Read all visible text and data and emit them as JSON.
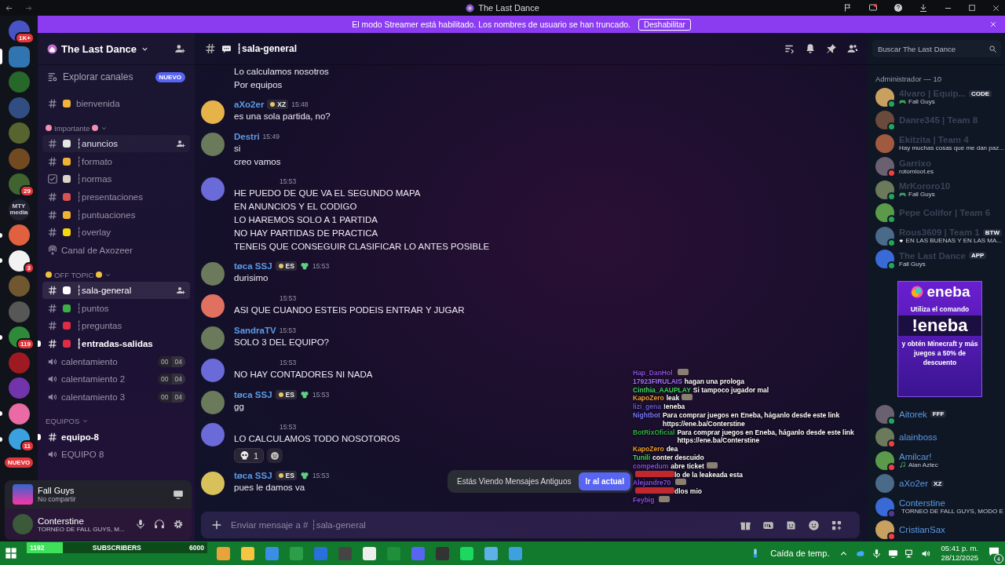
{
  "window": {
    "title": "The Last Dance"
  },
  "servers": [
    {
      "badge": "1K+",
      "selected": false,
      "unread": false
    },
    {
      "selected": true,
      "unread": false
    },
    {
      "selected": false,
      "unread": false
    },
    {
      "selected": false,
      "unread": false
    },
    {
      "selected": false,
      "unread": false
    },
    {
      "selected": false,
      "unread": false
    },
    {
      "badge": "29",
      "selected": false,
      "unread": false
    },
    {
      "label": "MTY media",
      "selected": false,
      "unread": false
    },
    {
      "selected": false,
      "unread": true
    },
    {
      "badge": "3",
      "selected": false,
      "unread": true
    },
    {
      "selected": false,
      "unread": false
    },
    {
      "selected": false,
      "unread": false
    },
    {
      "badge": "119",
      "selected": false,
      "unread": true
    },
    {
      "selected": false,
      "unread": false
    },
    {
      "selected": false,
      "unread": false
    },
    {
      "selected": false,
      "unread": true
    },
    {
      "badge": "11",
      "selected": false,
      "unread": true
    }
  ],
  "servers_footer": {
    "label": "NUEVO"
  },
  "streamer_banner": {
    "text": "El modo Streamer está habilitado. Los nombres de usuario se han truncado.",
    "button": "Deshabilitar"
  },
  "guild": {
    "name": "The Last Dance"
  },
  "explore": {
    "label": "Explorar canales",
    "badge": "NUEVO"
  },
  "channels": [
    {
      "kind": "text",
      "name": "bienvenida",
      "color": "#f2b53a",
      "selected": false,
      "unread": false,
      "hovered": false
    },
    {
      "kind": "category",
      "name": "Importante",
      "color": "#f08fb0",
      "expanded": true
    },
    {
      "kind": "text",
      "name": "┆anuncios",
      "color": "#e6e6e6",
      "selected": false,
      "unread": false,
      "hovered": true
    },
    {
      "kind": "text",
      "name": "┆formato",
      "color": "#f0b232",
      "selected": false,
      "unread": false,
      "hovered": false
    },
    {
      "kind": "rules",
      "name": "┆normas",
      "color": "#d9d2c5",
      "selected": false,
      "unread": false,
      "hovered": false
    },
    {
      "kind": "text",
      "name": "┆presentaciones",
      "color": "#d9534f",
      "selected": false,
      "unread": false,
      "hovered": false
    },
    {
      "kind": "text",
      "name": "┆puntuaciones",
      "color": "#f0b232",
      "selected": false,
      "unread": false,
      "hovered": false
    },
    {
      "kind": "text",
      "name": "┆overlay",
      "color": "#f5d90a",
      "selected": false,
      "unread": false,
      "hovered": false
    },
    {
      "kind": "stage",
      "name": "Canal de Axozeer",
      "selected": false,
      "unread": false,
      "hovered": false
    },
    {
      "kind": "category",
      "name": "OFF TOPIC",
      "color": "#f0c040",
      "expanded": true
    },
    {
      "kind": "text",
      "name": "┆sala-general",
      "color": "#ffffff",
      "selected": true,
      "unread": false,
      "hovered": false
    },
    {
      "kind": "text",
      "name": "┆puntos",
      "color": "#3bb143",
      "selected": false,
      "unread": false,
      "hovered": false
    },
    {
      "kind": "text",
      "name": "┆preguntas",
      "color": "#dd2e44",
      "selected": false,
      "unread": false,
      "hovered": false
    },
    {
      "kind": "text",
      "name": "┆entradas-salidas",
      "color": "#dd2e44",
      "selected": false,
      "unread": true,
      "hovered": false
    },
    {
      "kind": "voice",
      "name": "calentamiento",
      "counts": [
        "00",
        "04"
      ],
      "selected": false,
      "unread": false,
      "hovered": false
    },
    {
      "kind": "voice",
      "name": "calentamiento 2",
      "counts": [
        "00",
        "04"
      ],
      "selected": false,
      "unread": false,
      "hovered": false
    },
    {
      "kind": "voice",
      "name": "calentamiento 3",
      "counts": [
        "00",
        "04"
      ],
      "selected": false,
      "unread": false,
      "hovered": false
    },
    {
      "kind": "category",
      "name": "EQUIPOS",
      "expanded": true
    },
    {
      "kind": "text",
      "name": "equipo-8",
      "selected": false,
      "unread": true,
      "hovered": false
    },
    {
      "kind": "voice",
      "name": "EQUIPO 8",
      "selected": false,
      "unread": false,
      "hovered": false
    }
  ],
  "activity": {
    "game": "Fall Guys",
    "status": "No compartir"
  },
  "user": {
    "name": "Conterstine",
    "status": "TORNEO DE FALL GUYS, M..."
  },
  "chat": {
    "channel": "┆sala-general",
    "messages": [
      {
        "lines": [
          "Lo calculamos nosotros",
          "Por equipos"
        ]
      },
      {
        "author": "aXo2er",
        "tag": "XZ",
        "emblem": false,
        "time": "15:48",
        "lines": [
          "es una sola partida, no?"
        ]
      },
      {
        "author": "Destri",
        "time": "15:49",
        "lines": [
          "si",
          "creo vamos"
        ]
      },
      {
        "time": "15:53",
        "lines": [
          "HE PUEDO DE QUE VA EL SEGUNDO MAPA",
          "EN ANUNCIOS Y EL CODIGO",
          "LO HAREMOS SOLO A 1 PARTIDA",
          "NO HAY PARTIDAS DE PRACTICA",
          "TENEIS QUE CONSEGUIR CLASIFICAR LO ANTES POSIBLE"
        ]
      },
      {
        "author": "tøca SSJ",
        "tag": "ES",
        "emblem": true,
        "time": "15:53",
        "lines": [
          "durisimo"
        ]
      },
      {
        "time": "15:53",
        "lines": [
          "ASI QUE CUANDO ESTEIS PODEIS ENTRAR Y JUGAR"
        ]
      },
      {
        "author": "SandraTV",
        "time": "15:53",
        "lines": [
          "SOLO 3 DEL EQUIPO?"
        ]
      },
      {
        "time": "15:53",
        "lines": [
          "NO HAY CONTADORES NI NADA"
        ]
      },
      {
        "author": "tøca SSJ",
        "tag": "ES",
        "emblem": true,
        "time": "15:53",
        "lines": [
          "gg"
        ]
      },
      {
        "time": "15:53",
        "lines": [
          "LO CALCULAMOS TODO NOSOTOROS"
        ],
        "reactions": [
          {
            "count": "1"
          }
        ]
      },
      {
        "author": "tøca SSJ",
        "tag": "ES",
        "emblem": true,
        "time": "15:53",
        "lines": [
          "pues le damos va"
        ]
      }
    ],
    "jump_bar": {
      "text": "Estás Viendo Mensajes Antiguos",
      "button": "Ir al actual"
    },
    "input": {
      "placeholder": "Enviar mensaje a # ┆sala-general"
    }
  },
  "search": {
    "placeholder": "Buscar The Last Dance"
  },
  "member_groups": [
    {
      "title": "Administrador — 10",
      "members": [
        {
          "name": "4lvaro | Equip...",
          "dim": true,
          "tag": "CODE",
          "color": "#23a55a",
          "activity": {
            "kind": "game",
            "text": "Fall Guys"
          }
        },
        {
          "name": "Danre345 | Team 8",
          "dim": true,
          "color": "#23a55a"
        },
        {
          "name": "Ekitzita | Team 4",
          "dim": true,
          "activity": {
            "kind": "custom",
            "text": "Hay muchas cosas que me dan paz..."
          }
        },
        {
          "name": "Garrixo",
          "dim": true,
          "color": "#f23f43",
          "activity": {
            "kind": "custom",
            "text": "rotomloot.es"
          }
        },
        {
          "name": "MrKororo10",
          "dim": true,
          "color": "#23a55a",
          "activity": {
            "kind": "game",
            "text": "Fall Guys"
          }
        },
        {
          "name": "Pepe Colifor | Team 6",
          "dim": true,
          "color": "#23a55a"
        },
        {
          "name": "Rous3609 | Team 1",
          "dim": true,
          "tag": "BTW",
          "color": "#23a55a",
          "activity": {
            "kind": "heart",
            "text": "EN LAS BUENAS Y EN LAS MA..."
          }
        },
        {
          "name": "The Last Dance",
          "dim": true,
          "tag": "APP",
          "color": "#23a55a",
          "activity": {
            "kind": "custom",
            "text": "Fall Guys"
          }
        }
      ]
    },
    {
      "members": [
        {
          "name": "Aitorek",
          "dim": false,
          "tag": "FFF",
          "color": "#23a55a"
        },
        {
          "name": "alainboss",
          "dim": false,
          "color": "#f23f43"
        },
        {
          "name": "Amilcar!",
          "dim": false,
          "color": "#f23f43",
          "activity": {
            "kind": "music",
            "text": "Alan Aztec"
          }
        },
        {
          "name": "aXo2er",
          "dim": false,
          "tag": "XZ"
        },
        {
          "name": "Conterstine",
          "dim": false,
          "color": "#593695",
          "activity": {
            "kind": "stream",
            "text": "TORNEO DE FALL GUYS, MODO E"
          }
        },
        {
          "name": "CristianSax",
          "dim": false,
          "color": "#f23f43"
        }
      ]
    }
  ],
  "ad": {
    "brand": "eneba",
    "line1": "Utiliza el comando",
    "command": "!eneba",
    "line2": "y obtén Minecraft y más juegos a 50% de descuento"
  },
  "stream_chat": [
    {
      "user": "Hap_DanHol",
      "color": "#8a4de0",
      "emote": true
    },
    {
      "user": "17923FIRULAIS",
      "color": "#a970ff",
      "text": "hagan una prologa",
      "emote": false
    },
    {
      "user": "Cinthia_AAUPLAY",
      "color": "#3ddc5a",
      "text": "Si tampoco jugador mal",
      "emote": false
    },
    {
      "user": "KapoZero",
      "color": "#f0a030",
      "text": "leak",
      "emote": true
    },
    {
      "user": "lizi_gena",
      "color": "#6a5acd",
      "text": "!eneba",
      "emote": false
    },
    {
      "user": "Nightbot",
      "color": "#7a7aff",
      "text": "Para comprar juegos en Eneba, háganlo desde este link https://ene.ba/Conterstine",
      "emote": false
    },
    {
      "user": "BotRixOficial",
      "color": "#2fae45",
      "text": "Para comprar juegos en Eneba, háganlo desde este link https://ene.ba/Conterstine",
      "emote": false
    },
    {
      "user": "KapoZero",
      "color": "#f0a030",
      "text": "dea",
      "emote": false
    },
    {
      "user": "Tunili",
      "color": "#3ddc5a",
      "text": "conter descuido",
      "emote": false
    },
    {
      "user": "compedum",
      "color": "#8a4de0",
      "text": "abre ticket",
      "emote": true
    },
    {
      "color": "#c0282d",
      "text": "lo de la leakeada esta",
      "emote": false
    },
    {
      "user": "Alejandre70",
      "color": "#8a4de0",
      "emote": true
    },
    {
      "color": "#c0282d",
      "text": "dlos mio",
      "emote": false
    },
    {
      "user": "Feybig",
      "color": "#8a4de0",
      "emote": true
    }
  ],
  "sub_goal": {
    "current": "1192",
    "label": "SUBSCRIBERS",
    "goal": "6000",
    "level": 0.2
  },
  "taskbar": {
    "weather": "Caída de temp.",
    "time": "05:41 p. m.",
    "date": "28/12/2025",
    "notifications": "4"
  }
}
